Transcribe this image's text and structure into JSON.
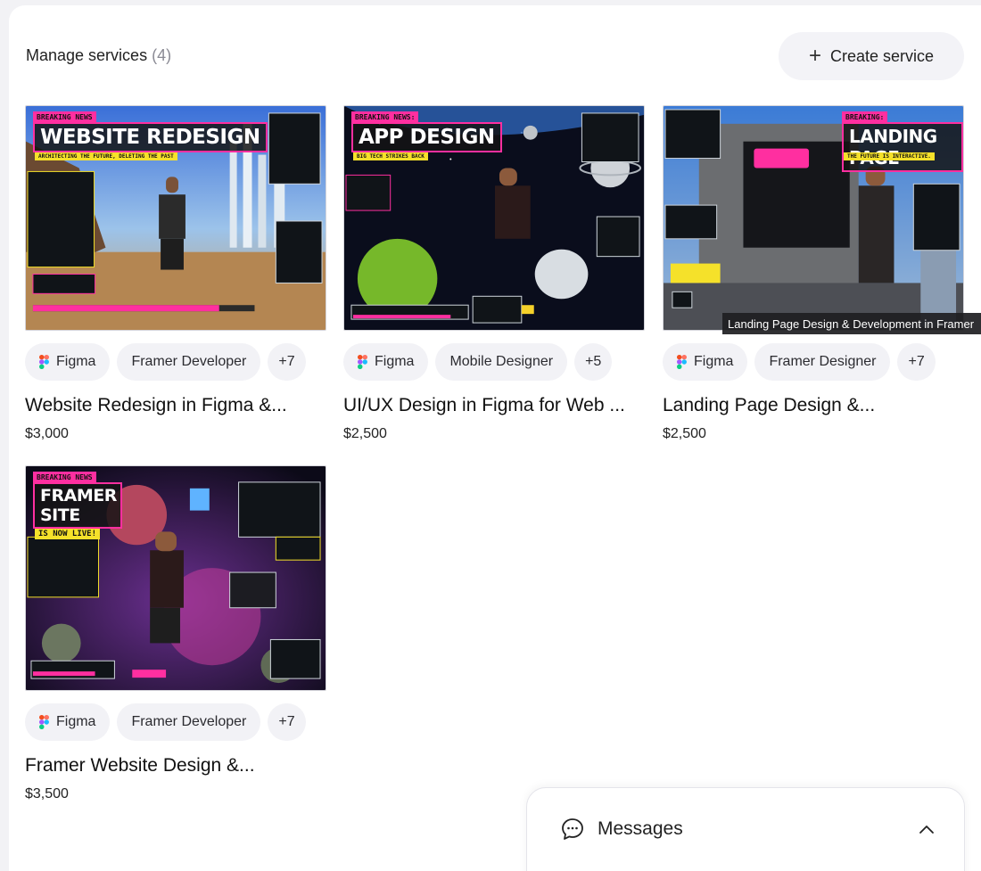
{
  "header": {
    "title": "Manage services",
    "count": "(4)",
    "create_label": "Create service"
  },
  "services": [
    {
      "thumb_badge": "BREAKING NEWS",
      "thumb_title": "WEBSITE REDESIGN",
      "thumb_sub": "ARCHITECTING THE FUTURE, DELETING THE PAST",
      "tags": [
        "Figma",
        "Framer Developer",
        "+7"
      ],
      "title": "Website Redesign in Figma &...",
      "price": "$3,000"
    },
    {
      "thumb_badge": "BREAKING NEWS:",
      "thumb_title": "APP DESIGN",
      "thumb_sub": "BIG TECH STRIKES BACK",
      "tags": [
        "Figma",
        "Mobile Designer",
        "+5"
      ],
      "title": "UI/UX Design in Figma for Web ...",
      "price": "$2,500"
    },
    {
      "thumb_badge": "BREAKING:",
      "thumb_title": "LANDING PAGE",
      "thumb_sub": "THE FUTURE IS INTERACTIVE.",
      "tags": [
        "Figma",
        "Framer Designer",
        "+7"
      ],
      "title": "Landing Page Design &...",
      "price": "$2,500"
    },
    {
      "thumb_badge": "BREAKING NEWS",
      "thumb_title": "FRAMER SITE",
      "thumb_sub": "IS NOW LIVE!",
      "tags": [
        "Figma",
        "Framer Developer",
        "+7"
      ],
      "title": "Framer Website Design &...",
      "price": "$3,500"
    }
  ],
  "tooltip": "Landing Page Design & Development in Framer",
  "messages": {
    "label": "Messages"
  },
  "colors": {
    "accent_pink": "#ff2fa0",
    "accent_yellow": "#f5e12a",
    "tag_bg": "#f2f2f6"
  }
}
